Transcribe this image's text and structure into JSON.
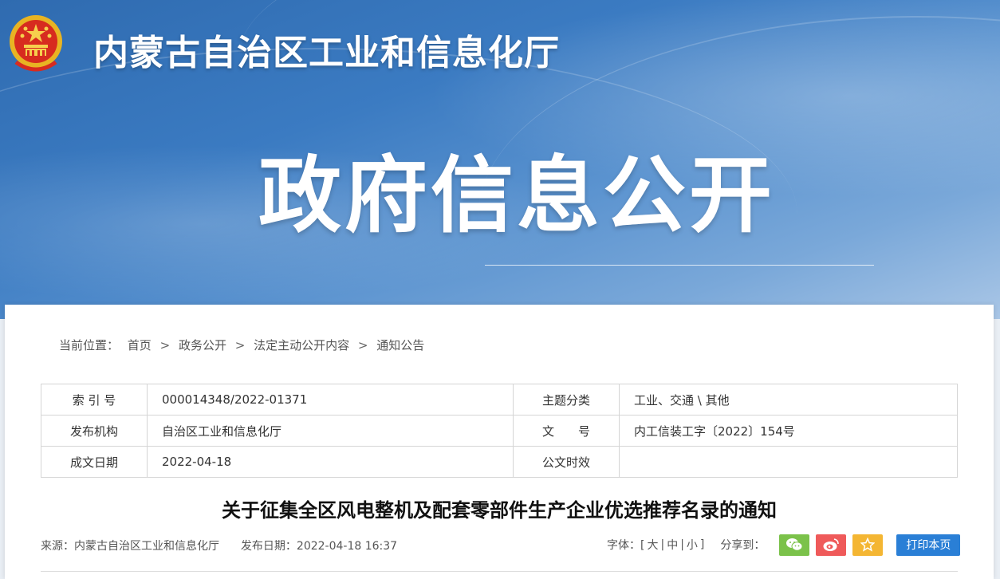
{
  "header": {
    "site_title": "内蒙古自治区工业和信息化厅",
    "banner_heading": "政府信息公开",
    "emblem_icon": "national-emblem-icon"
  },
  "breadcrumb": {
    "label": "当前位置：",
    "items": [
      "首页",
      "政务公开",
      "法定主动公开内容",
      "通知公告"
    ],
    "separator": ">"
  },
  "meta": {
    "index_no_label": "索 引 号",
    "index_no": "000014348/2022-01371",
    "topic_label": "主题分类",
    "topic": "工业、交通 \\ 其他",
    "publisher_label": "发布机构",
    "publisher": "自治区工业和信息化厅",
    "doc_no_label": "文　　号",
    "doc_no": "内工信装工字〔2022〕154号",
    "date_label": "成文日期",
    "date": "2022-04-18",
    "effective_label": "公文时效",
    "effective": ""
  },
  "article": {
    "title": "关于征集全区风电整机及配套零部件生产企业优选推荐名录的通知",
    "source": "来源：内蒙古自治区工业和信息化厅",
    "published": "发布日期：2022-04-18 16:37"
  },
  "tools": {
    "font_label": "字体：[",
    "font_large": "大",
    "font_medium": "中",
    "font_small": "小",
    "font_end": "]",
    "divider": "|",
    "share_label": "分享到：",
    "print_label": "打印本页",
    "colors": {
      "wechat": "#7bc24a",
      "weibo": "#ef5a5a",
      "favorite": "#f4b633",
      "print": "#2a7fd6"
    }
  }
}
